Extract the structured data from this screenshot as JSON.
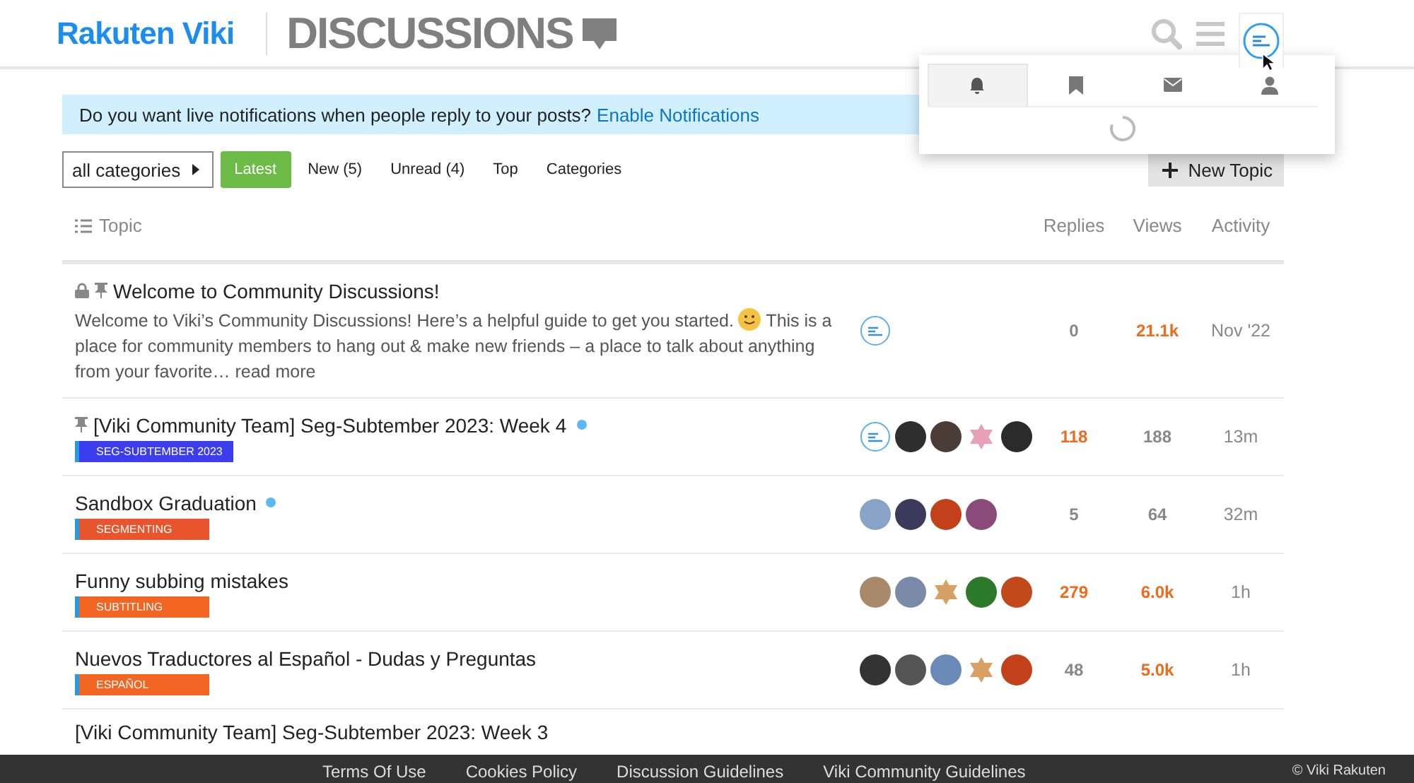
{
  "header": {
    "brand": "Rakuten Viki",
    "section": "DISCUSSIONS"
  },
  "menu": {
    "tabs": [
      {
        "kind": "bell",
        "selected": true
      },
      {
        "kind": "bookmark",
        "selected": false
      },
      {
        "kind": "mail",
        "selected": false
      },
      {
        "kind": "user",
        "selected": false
      }
    ],
    "loading": true
  },
  "banner": {
    "text": "Do you want live notifications when people reply to your posts?",
    "link": "Enable Notifications"
  },
  "filters": {
    "category": "all categories",
    "tabs": [
      {
        "label": "Latest",
        "selected": true
      },
      {
        "label": "New (5)",
        "selected": false
      },
      {
        "label": "Unread (4)",
        "selected": false
      },
      {
        "label": "Top",
        "selected": false
      },
      {
        "label": "Categories",
        "selected": false
      }
    ],
    "new_topic": "New Topic"
  },
  "table": {
    "columns": [
      "Topic",
      "Replies",
      "Views",
      "Activity"
    ],
    "rows": [
      {
        "title": "Welcome to Community Discussions!",
        "locked": true,
        "pinned": true,
        "unread": false,
        "excerpt_before": "Welcome to Viki’s Community Discussions! Here’s a helpful guide to get you started.",
        "excerpt_after": "This is a place for community members to hang out & make new friends – a place to talk about anything from your favorite…",
        "read_more": "read more",
        "posters": [
          {
            "kind": "logo"
          }
        ],
        "replies": "0",
        "replies_hot": false,
        "views": "21.1k",
        "views_hot": true,
        "activity": "Nov '22"
      },
      {
        "title": "[Viki Community Team] Seg-Subtember 2023: Week 4",
        "locked": false,
        "pinned": true,
        "unread": true,
        "category": {
          "name": "SEG-SUBTEMBER 2023",
          "color": "#3d3df0"
        },
        "posters": [
          {
            "kind": "logo"
          },
          {
            "kind": "photo",
            "color": "#2e2e2e"
          },
          {
            "kind": "photo",
            "color": "#4a3c36"
          },
          {
            "kind": "star",
            "color": "#e8a0b4"
          },
          {
            "kind": "photo",
            "color": "#2b2b2b"
          }
        ],
        "replies": "118",
        "replies_hot": true,
        "views": "188",
        "views_hot": false,
        "activity": "13m"
      },
      {
        "title": "Sandbox Graduation",
        "locked": false,
        "pinned": false,
        "unread": true,
        "category": {
          "name": "SEGMENTING",
          "color": "#e8542c"
        },
        "posters": [
          {
            "kind": "photo",
            "color": "#8aa4c8"
          },
          {
            "kind": "photo",
            "color": "#3a3a5a"
          },
          {
            "kind": "photo",
            "color": "#c2401a"
          },
          {
            "kind": "photo",
            "color": "#8a4a7a"
          }
        ],
        "replies": "5",
        "replies_hot": false,
        "views": "64",
        "views_hot": false,
        "activity": "32m"
      },
      {
        "title": "Funny subbing mistakes",
        "locked": false,
        "pinned": false,
        "unread": false,
        "category": {
          "name": "SUBTITLING",
          "color": "#f26522"
        },
        "posters": [
          {
            "kind": "photo",
            "color": "#a88a6a"
          },
          {
            "kind": "photo",
            "color": "#7a8aa8"
          },
          {
            "kind": "star",
            "color": "#d9a066"
          },
          {
            "kind": "photo",
            "color": "#2a7a2a"
          },
          {
            "kind": "photo",
            "color": "#c24a1a"
          }
        ],
        "replies": "279",
        "replies_hot": true,
        "views": "6.0k",
        "views_hot": true,
        "activity": "1h"
      },
      {
        "title": "Nuevos Traductores al Español - Dudas y Preguntas",
        "locked": false,
        "pinned": false,
        "unread": false,
        "category": {
          "name": "ESPAÑOL",
          "color": "#f26522"
        },
        "posters": [
          {
            "kind": "photo",
            "color": "#333333"
          },
          {
            "kind": "photo",
            "color": "#555555"
          },
          {
            "kind": "photo",
            "color": "#6a8ab8"
          },
          {
            "kind": "star",
            "color": "#d9a066"
          },
          {
            "kind": "photo",
            "color": "#c2401a"
          }
        ],
        "replies": "48",
        "replies_hot": false,
        "views": "5.0k",
        "views_hot": true,
        "activity": "1h"
      },
      {
        "title": "[Viki Community Team] Seg-Subtember 2023: Week 3",
        "locked": false,
        "pinned": false,
        "unread": false
      }
    ]
  },
  "footer": {
    "links": [
      "Terms Of Use",
      "Cookies Policy",
      "Discussion Guidelines",
      "Viki Community Guidelines"
    ],
    "copyright": "© Viki Rakuten"
  }
}
